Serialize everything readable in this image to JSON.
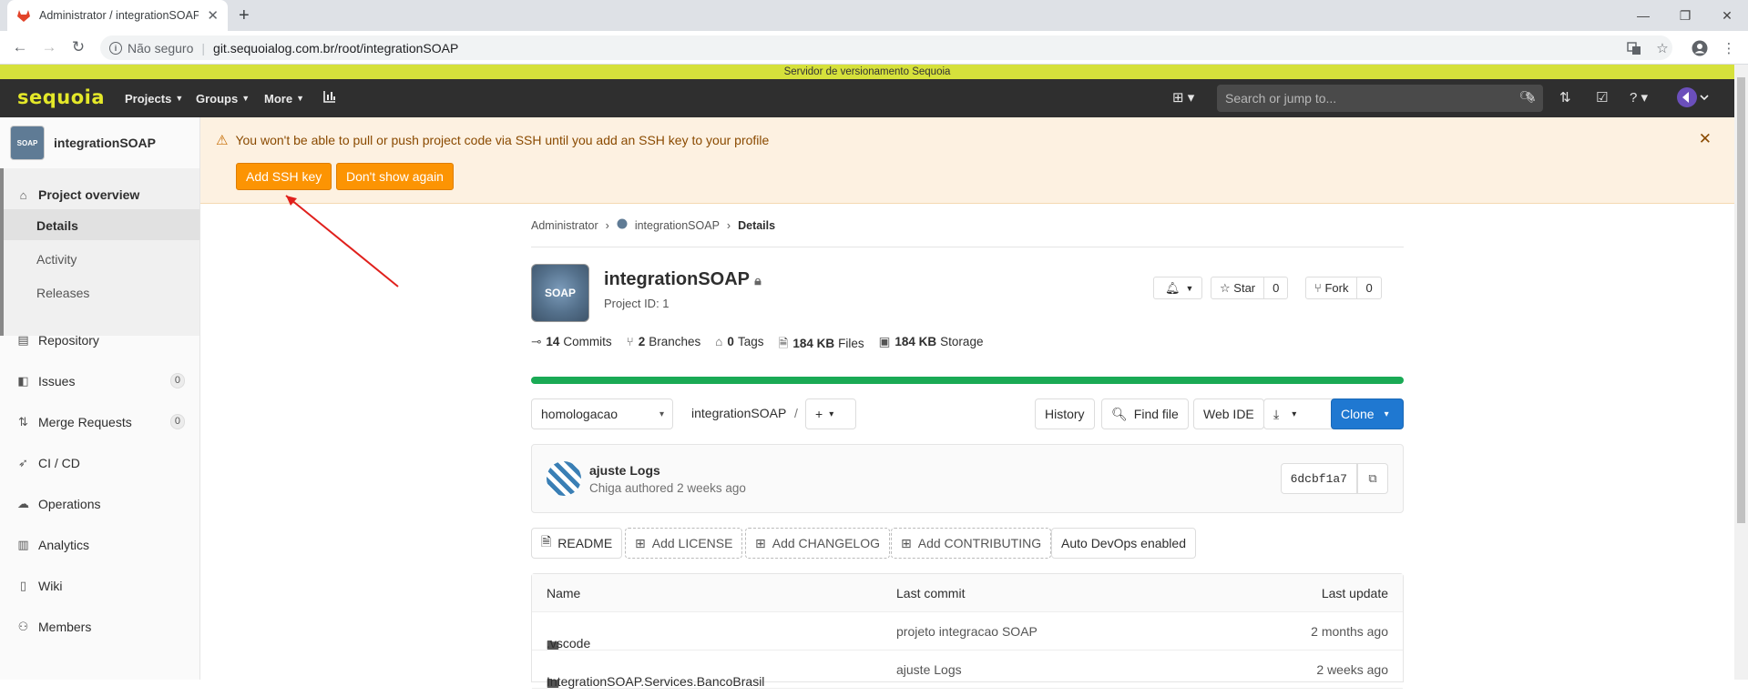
{
  "browser": {
    "tab_title": "Administrator / integrationSOAP",
    "insecure_label": "Não seguro",
    "url": "git.sequoialog.com.br/root/integrationSOAP"
  },
  "system_header": "Servidor de versionamento Sequoia",
  "topnav": {
    "logo": "sequoia",
    "projects": "Projects",
    "groups": "Groups",
    "more": "More",
    "search_placeholder": "Search or jump to..."
  },
  "sidebar": {
    "project_name": "integrationSOAP",
    "avatar_text": "SOAP",
    "overview": "Project overview",
    "sub_items": [
      "Details",
      "Activity",
      "Releases"
    ],
    "items": [
      {
        "label": "Repository"
      },
      {
        "label": "Issues",
        "badge": "0"
      },
      {
        "label": "Merge Requests",
        "badge": "0"
      },
      {
        "label": "CI / CD"
      },
      {
        "label": "Operations"
      },
      {
        "label": "Analytics"
      },
      {
        "label": "Wiki"
      },
      {
        "label": "Members"
      }
    ]
  },
  "alert": {
    "message": "You won't be able to pull or push project code via SSH until you add an SSH key to your profile",
    "add_ssh": "Add SSH key",
    "dont_show": "Don't show again"
  },
  "breadcrumb": {
    "root": "Administrator",
    "project": "integrationSOAP",
    "current": "Details"
  },
  "project": {
    "name": "integrationSOAP",
    "avatar_text": "SOAP",
    "id_label": "Project ID: 1",
    "star_label": "Star",
    "star_count": "0",
    "fork_label": "Fork",
    "fork_count": "0"
  },
  "stats": {
    "commits_n": "14",
    "commits": "Commits",
    "branches_n": "2",
    "branches": "Branches",
    "tags_n": "0",
    "tags": "Tags",
    "files_n": "184 KB",
    "files": "Files",
    "storage_n": "184 KB",
    "storage": "Storage"
  },
  "repo_toolbar": {
    "branch": "homologacao",
    "path": "integrationSOAP",
    "path_sep": "/",
    "history": "History",
    "find_file": "Find file",
    "web_ide": "Web IDE",
    "clone": "Clone"
  },
  "last_commit": {
    "title": "ajuste Logs",
    "meta": "Chiga authored 2 weeks ago",
    "sha": "6dcbf1a7"
  },
  "file_buttons": {
    "readme": "README",
    "add_license": "Add LICENSE",
    "add_changelog": "Add CHANGELOG",
    "add_contributing": "Add CONTRIBUTING",
    "auto_devops": "Auto DevOps enabled"
  },
  "files_table": {
    "headers": [
      "Name",
      "Last commit",
      "Last update"
    ],
    "rows": [
      {
        "name": ".vscode",
        "commit": "projeto integracao SOAP",
        "updated": "2 months ago"
      },
      {
        "name": "IntegrationSOAP.Services.BancoBrasil",
        "commit": "ajuste Logs",
        "updated": "2 weeks ago"
      }
    ]
  },
  "colors": {
    "system_header_bg": "#d6e13b",
    "topnav_bg": "#2f2f2f",
    "alert_bg": "#fdf1e1",
    "orange_button": "#fc9403",
    "progress": "#1aaa55",
    "clone_blue": "#1f78d1",
    "arrow": "#e0201c"
  }
}
